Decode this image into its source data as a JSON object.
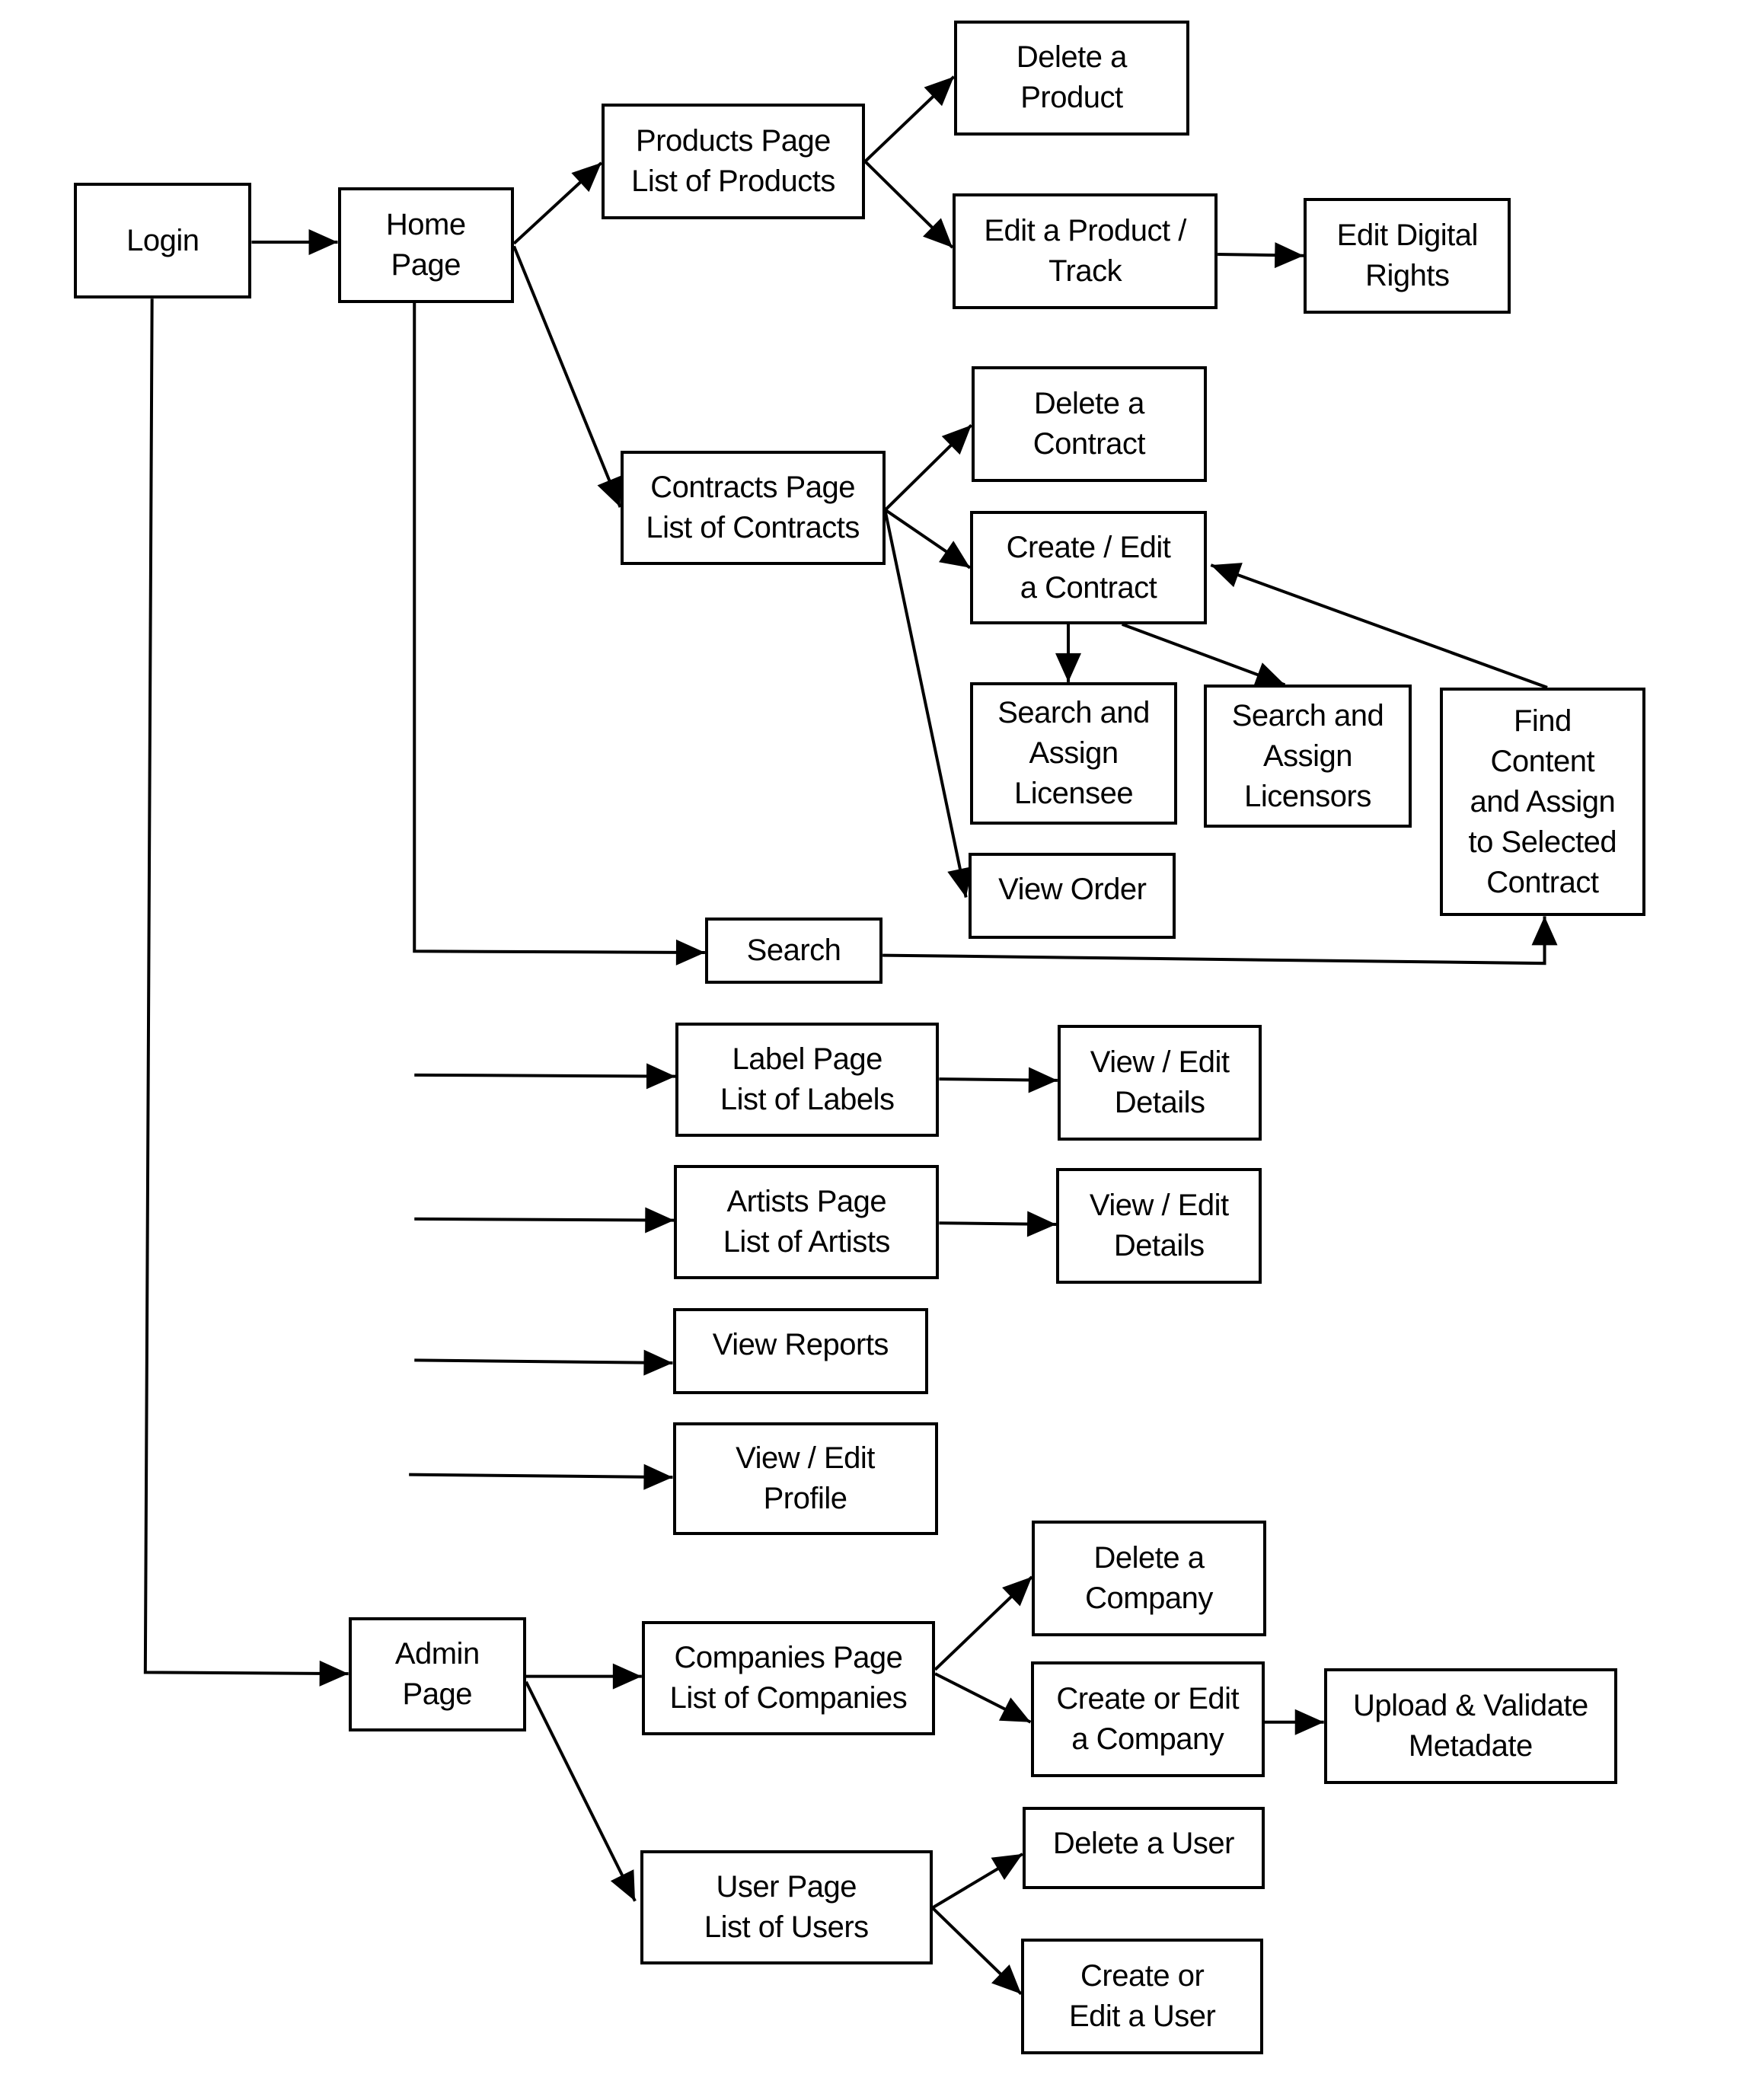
{
  "diagram": {
    "type": "site-navigation-flowchart",
    "colors": {
      "stroke": "#000000",
      "background": "#ffffff",
      "text": "#000000"
    },
    "nodes": [
      {
        "id": "login",
        "label": "Login"
      },
      {
        "id": "home",
        "label": "Home\nPage"
      },
      {
        "id": "products",
        "label": "Products Page\nList of Products"
      },
      {
        "id": "delete-product",
        "label": "Delete a\nProduct"
      },
      {
        "id": "edit-product",
        "label": "Edit a Product /\nTrack"
      },
      {
        "id": "edit-digital-rights",
        "label": "Edit Digital\nRights"
      },
      {
        "id": "contracts",
        "label": "Contracts Page\nList of Contracts"
      },
      {
        "id": "delete-contract",
        "label": "Delete a\nContract"
      },
      {
        "id": "create-edit-contract",
        "label": "Create / Edit\na Contract"
      },
      {
        "id": "assign-licensee",
        "label": "Search and\nAssign\nLicensee"
      },
      {
        "id": "assign-licensors",
        "label": "Search and\nAssign\nLicensors"
      },
      {
        "id": "find-content",
        "label": "Find\nContent\nand Assign\nto Selected\nContract"
      },
      {
        "id": "view-order",
        "label": "View Order"
      },
      {
        "id": "search",
        "label": "Search"
      },
      {
        "id": "labels",
        "label": "Label Page\nList of Labels"
      },
      {
        "id": "label-details",
        "label": "View / Edit\nDetails"
      },
      {
        "id": "artists",
        "label": "Artists Page\nList of Artists"
      },
      {
        "id": "artist-details",
        "label": "View / Edit\nDetails"
      },
      {
        "id": "reports",
        "label": "View Reports"
      },
      {
        "id": "profile",
        "label": "View / Edit\nProfile"
      },
      {
        "id": "admin",
        "label": "Admin\nPage"
      },
      {
        "id": "companies",
        "label": "Companies Page\nList of Companies"
      },
      {
        "id": "delete-company",
        "label": "Delete a\nCompany"
      },
      {
        "id": "create-edit-company",
        "label": "Create or Edit\na Company"
      },
      {
        "id": "upload-metadata",
        "label": "Upload & Validate\nMetadate"
      },
      {
        "id": "users",
        "label": "User Page\nList of Users"
      },
      {
        "id": "delete-user",
        "label": "Delete a User"
      },
      {
        "id": "create-edit-user",
        "label": "Create or\nEdit a User"
      }
    ],
    "edges": [
      {
        "from": "login",
        "to": "home"
      },
      {
        "from": "login",
        "to": "admin"
      },
      {
        "from": "home",
        "to": "products"
      },
      {
        "from": "home",
        "to": "contracts"
      },
      {
        "from": "home",
        "to": "search"
      },
      {
        "from": "home",
        "to": "labels"
      },
      {
        "from": "home",
        "to": "artists"
      },
      {
        "from": "home",
        "to": "reports"
      },
      {
        "from": "home",
        "to": "profile"
      },
      {
        "from": "products",
        "to": "delete-product"
      },
      {
        "from": "products",
        "to": "edit-product"
      },
      {
        "from": "edit-product",
        "to": "edit-digital-rights"
      },
      {
        "from": "contracts",
        "to": "delete-contract"
      },
      {
        "from": "contracts",
        "to": "create-edit-contract"
      },
      {
        "from": "contracts",
        "to": "view-order"
      },
      {
        "from": "create-edit-contract",
        "to": "assign-licensee"
      },
      {
        "from": "create-edit-contract",
        "to": "assign-licensors"
      },
      {
        "from": "find-content",
        "to": "create-edit-contract"
      },
      {
        "from": "search",
        "to": "find-content"
      },
      {
        "from": "labels",
        "to": "label-details"
      },
      {
        "from": "artists",
        "to": "artist-details"
      },
      {
        "from": "admin",
        "to": "companies"
      },
      {
        "from": "admin",
        "to": "users"
      },
      {
        "from": "companies",
        "to": "delete-company"
      },
      {
        "from": "companies",
        "to": "create-edit-company"
      },
      {
        "from": "create-edit-company",
        "to": "upload-metadata"
      },
      {
        "from": "users",
        "to": "delete-user"
      },
      {
        "from": "users",
        "to": "create-edit-user"
      }
    ]
  }
}
